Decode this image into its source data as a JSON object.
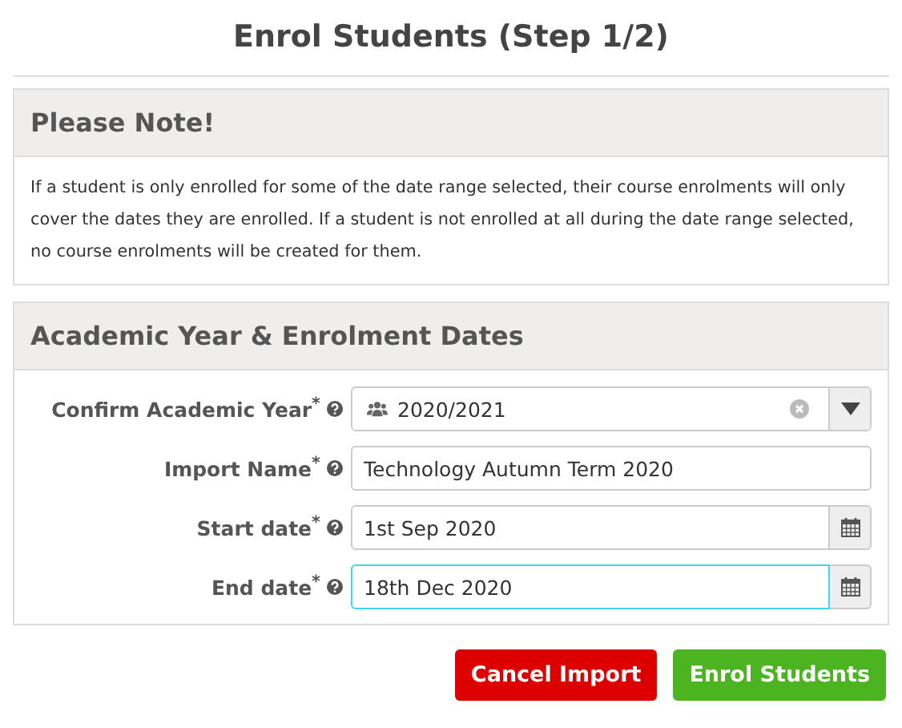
{
  "title": "Enrol Students (Step 1/2)",
  "note": {
    "heading": "Please Note!",
    "text": "If a student is only enrolled for some of the date range selected, their course enrolments will only cover the dates they are enrolled. If a student is not enrolled at all during the date range selected, no course enrolments will be created for them."
  },
  "form": {
    "heading": "Academic Year & Enrolment Dates",
    "fields": [
      {
        "kind": "select",
        "label": "Confirm Academic Year$^{*}$",
        "value": "2020/2021",
        "focused": false
      },
      {
        "kind": "text",
        "label": "Import Name$^{*}$",
        "value": "Technology Autumn Term 2020",
        "focused": false
      },
      {
        "kind": "date",
        "label": "Start date$^{*}$",
        "value": "1st Sep 2020",
        "focused": false
      },
      {
        "kind": "date",
        "label": "End date$^{*}$",
        "value": "18th Dec 2020",
        "focused": true
      }
    ]
  },
  "buttons": [
    {
      "kind": "danger",
      "label": "Cancel Import"
    },
    {
      "kind": "success",
      "label": "Enrol Students"
    }
  ]
}
